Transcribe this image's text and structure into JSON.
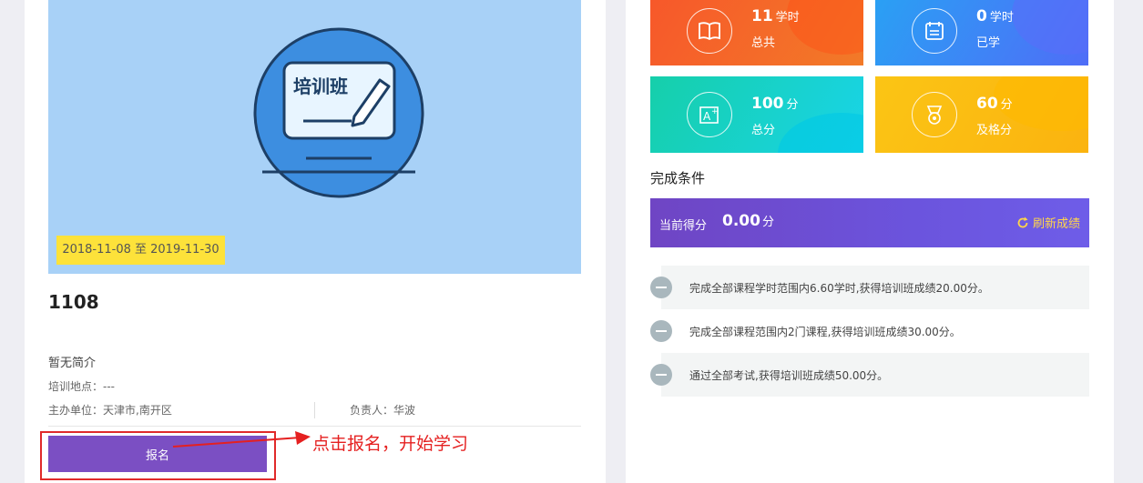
{
  "course": {
    "cover_text": "培训班",
    "date_range": "2018-11-08 至 2019-11-30",
    "title": "1108",
    "intro": "暂无简介",
    "location": "培训地点：---",
    "sponsor": "主办单位：天津市,南开区",
    "owner": "负责人：华波",
    "enroll_label": "报名"
  },
  "annotation": {
    "text": "点击报名，开始学习",
    "color": "#e52020"
  },
  "stats": [
    {
      "value": "11",
      "unit": "学时",
      "label": "总共",
      "icon": "book-icon",
      "color": "#f7582a"
    },
    {
      "value": "0",
      "unit": "学时",
      "label": "已学",
      "icon": "calendar-icon",
      "color": "#3b8ff6"
    },
    {
      "value": "100",
      "unit": "分",
      "label": "总分",
      "icon": "grade-icon",
      "color": "#1fd3c3"
    },
    {
      "value": "60",
      "unit": "分",
      "label": "及格分",
      "icon": "medal-icon",
      "color": "#fbbf15"
    }
  ],
  "completion": {
    "title": "完成条件",
    "score_label": "当前得分",
    "score_value": "0.00",
    "score_unit": "分",
    "refresh_label": "刷新成绩",
    "conditions": [
      "完成全部课程学时范围内6.60学时,获得培训班成绩20.00分。",
      "完成全部课程范围内2门课程,获得培训班成绩30.00分。",
      "通过全部考试,获得培训班成绩50.00分。"
    ]
  }
}
